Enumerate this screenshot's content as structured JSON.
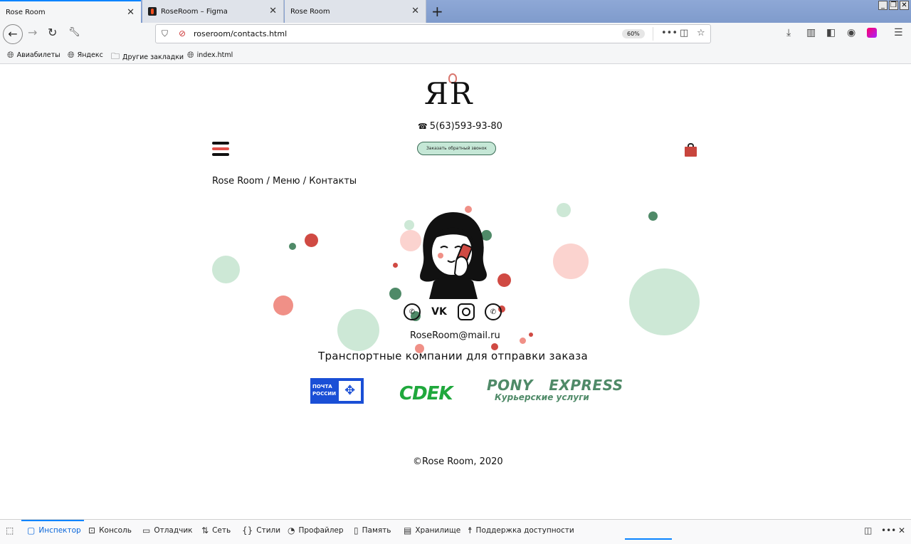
{
  "browser": {
    "tabs": [
      {
        "title": "Rose Room",
        "active": true
      },
      {
        "title": "RoseRoom – Figma",
        "active": false
      },
      {
        "title": "Rose Room",
        "active": false
      }
    ],
    "url": "roseroom/contacts.html",
    "zoom": "60%",
    "bookmarks": [
      "Авиабилеты",
      "Яндекс",
      "Другие закладки",
      "index.html"
    ]
  },
  "site": {
    "logo_text": "ЯR",
    "phone": "5(63)593-93-80",
    "callback_button": "Заказать обратный звонок",
    "breadcrumb": "Rose Room / Меню / Контакты",
    "socials": [
      "viber-icon",
      "vk-icon",
      "instagram-icon",
      "whatsapp-icon"
    ],
    "email": "RoseRoom@mail.ru",
    "transport_heading": "Транспортные компании для отправки заказа",
    "carriers": {
      "pochta_line1": "ПОЧТА",
      "pochta_line2": "РОССИИ",
      "cdek": "CDEK",
      "pony_line1": "PONY   EXPRESS",
      "pony_line2": "Курьерские услуги"
    },
    "footer": "©Rose Room, 2020",
    "colors": {
      "accent_green": "#c5e7d6",
      "accent_red": "#e0504a",
      "dark_green": "#4f8a68"
    }
  },
  "devtools": {
    "tabs": [
      "Инспектор",
      "Консоль",
      "Отладчик",
      "Сеть",
      "Стили",
      "Профайлер",
      "Память",
      "Хранилище",
      "Поддержка доступности"
    ]
  }
}
